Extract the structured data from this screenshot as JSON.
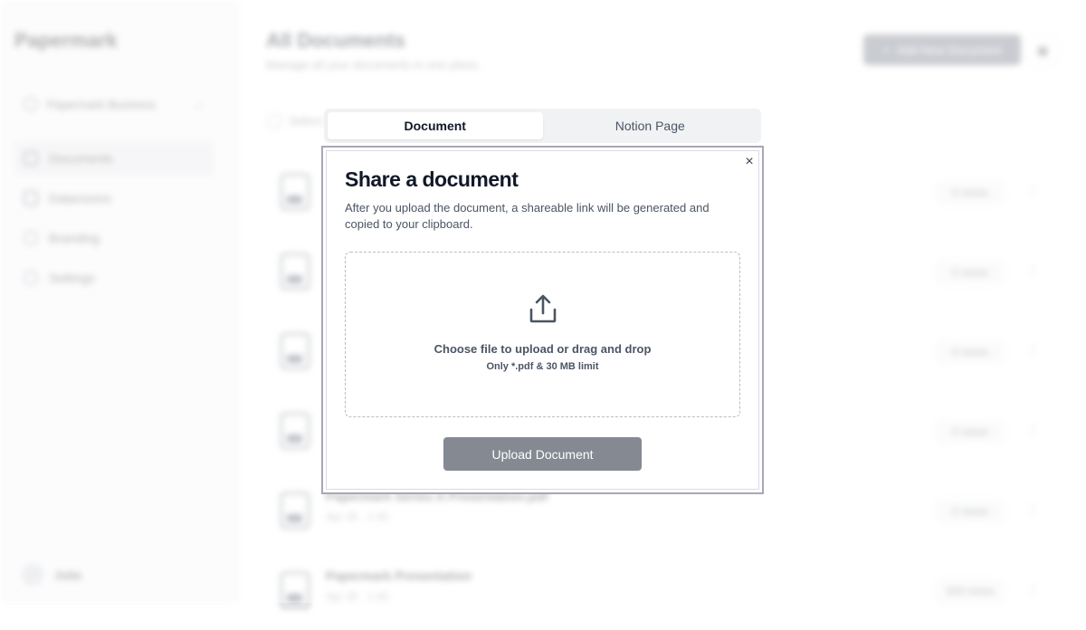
{
  "app": {
    "brand": "Papermark",
    "team": "Papermark Business",
    "nav": [
      {
        "label": "Documents"
      },
      {
        "label": "Datarooms"
      },
      {
        "label": "Branding"
      },
      {
        "label": "Settings"
      }
    ],
    "user": "Julia"
  },
  "main": {
    "title": "All Documents",
    "subtitle": "Manage all your documents in one place.",
    "add_button": "Add New Document",
    "select_all": "Select all",
    "documents": [
      {
        "name": "",
        "meta": "",
        "views": "0 views"
      },
      {
        "name": "",
        "meta": "",
        "views": "0 views"
      },
      {
        "name": "",
        "meta": "",
        "views": "0 views"
      },
      {
        "name": "",
        "meta": "",
        "views": "0 views"
      },
      {
        "name": "Papermark Series A Presentation.pdf",
        "meta": "Apr 20 · 1:45",
        "views": "0 views"
      },
      {
        "name": "Papermark Presentation",
        "meta": "Apr 20 · 1:45",
        "views": "300 views"
      }
    ]
  },
  "modal": {
    "tabs": [
      {
        "label": "Document",
        "active": true
      },
      {
        "label": "Notion Page",
        "active": false
      }
    ],
    "close_icon": "×",
    "title": "Share a document",
    "description": "After you upload the document, a shareable link will be generated and copied to your clipboard.",
    "dropzone": {
      "icon": "upload-icon",
      "primary": "Choose file to upload or drag and drop",
      "secondary": "Only *.pdf & 30 MB limit"
    },
    "upload_button": "Upload Document",
    "colors": {
      "button_bg": "#858992",
      "dialog_border": "#a7a7b7",
      "tab_track": "#f1f2f4"
    }
  }
}
